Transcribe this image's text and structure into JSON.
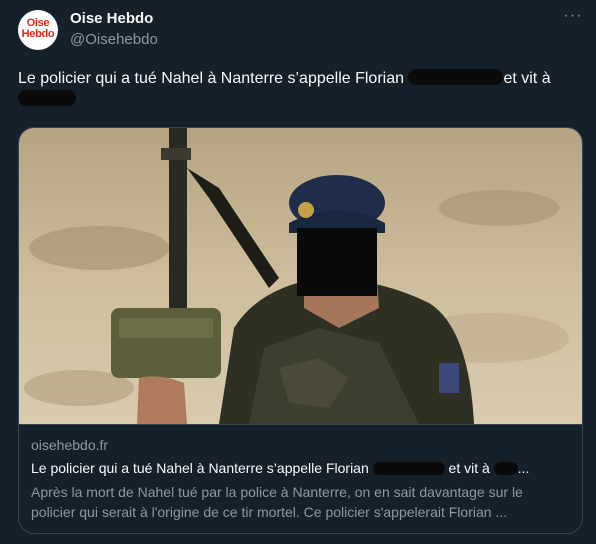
{
  "account": {
    "name": "Oise Hebdo",
    "handle": "@Oisehebdo",
    "avatar_text": [
      "Oise",
      "Hebdo"
    ],
    "avatar_color": "#e1261c"
  },
  "more_label": "···",
  "tweet": {
    "text_part1": "Le policier qui a tué Nahel à Nanterre s’appelle Florian ",
    "text_part2": "et vit à"
  },
  "card": {
    "domain": "oisehebdo.fr",
    "title_part1": "Le policier qui a tué Nahel à Nanterre s’appelle Florian ",
    "title_part2": " et vit à ",
    "title_ellipsis": "...",
    "description": "Après la mort de Nahel tué par la police à Nanterre, on en sait davantage sur le policier qui serait à l'origine de ce tir mortel. Ce policier s'appelerait Florian ..."
  },
  "colors": {
    "background": "#15202b",
    "text": "#f7f9f9",
    "secondary": "#8b98a5",
    "border": "#38444d",
    "redaction": "#0a0a0a"
  }
}
